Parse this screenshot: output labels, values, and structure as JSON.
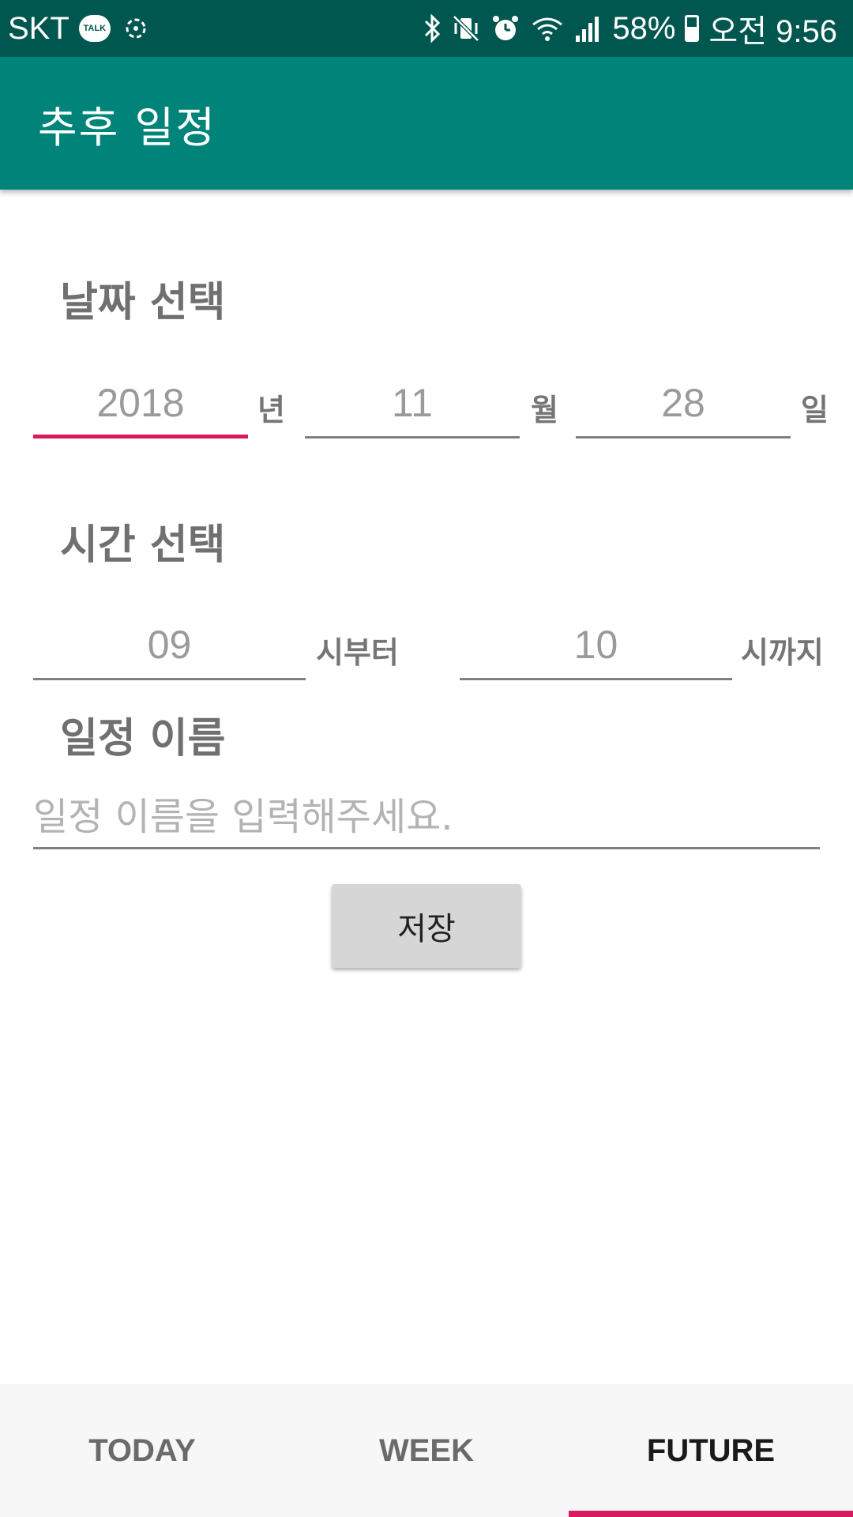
{
  "status_bar": {
    "carrier": "SKT",
    "talk_badge": "TALK",
    "battery": "58%",
    "time": "오전 9:56",
    "icons": [
      "kakaotalk-icon",
      "sync-icon",
      "bluetooth-icon",
      "vibrate-icon",
      "alarm-icon",
      "wifi-icon",
      "signal-icon",
      "battery-icon"
    ]
  },
  "app_bar": {
    "title": "추후 일정"
  },
  "date_section": {
    "title": "날짜 선택",
    "year": {
      "value": "2018",
      "unit": "년"
    },
    "month": {
      "value": "11",
      "unit": "월"
    },
    "day": {
      "value": "28",
      "unit": "일"
    }
  },
  "time_section": {
    "title": "시간 선택",
    "start": {
      "value": "09",
      "unit": "시부터"
    },
    "end": {
      "value": "10",
      "unit": "시까지"
    }
  },
  "name_section": {
    "title": "일정 이름",
    "placeholder": "일정 이름을 입력해주세요.",
    "value": ""
  },
  "save_button": {
    "label": "저장"
  },
  "bottom_nav": {
    "tabs": [
      {
        "label": "TODAY",
        "active": false
      },
      {
        "label": "WEEK",
        "active": false
      },
      {
        "label": "FUTURE",
        "active": true
      }
    ]
  },
  "colors": {
    "status_bar": "#00574f",
    "app_bar": "#00847a",
    "accent": "#d81b60"
  }
}
